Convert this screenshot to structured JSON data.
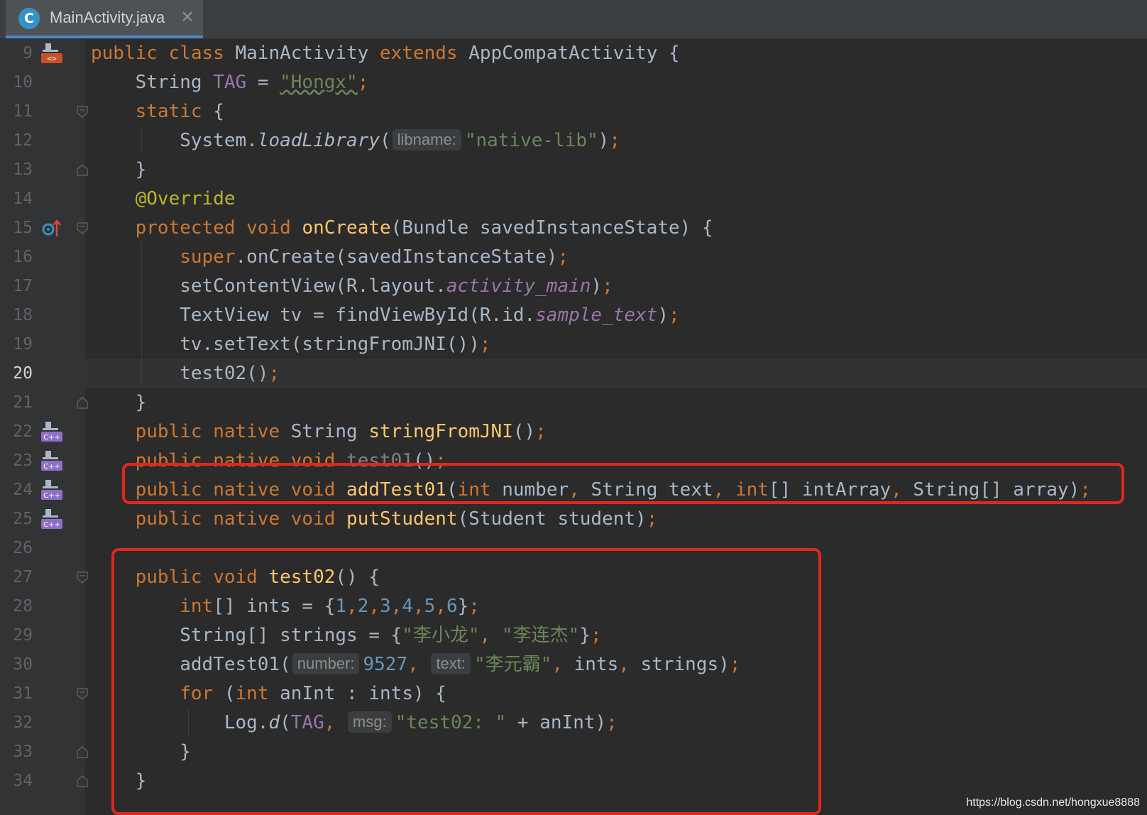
{
  "tab": {
    "icon_letter": "C",
    "title": "MainActivity.java",
    "close": "✕"
  },
  "editor": {
    "current_line": 20,
    "hints": {
      "libname": "libname:",
      "number": "number:",
      "text": "text:",
      "msg": "msg:"
    },
    "strings": {
      "hongx": "\"Hongx\"",
      "native_lib": "\"native-lib\"",
      "li1": "\"李小龙\"",
      "li2": "\"李连杰\"",
      "li3": "\"李元霸\"",
      "test02msg": "\"test02: \""
    },
    "line_numbers": [
      "9",
      "10",
      "11",
      "12",
      "13",
      "14",
      "15",
      "16",
      "17",
      "18",
      "19",
      "20",
      "21",
      "22",
      "23",
      "24",
      "25",
      "26",
      "27",
      "28",
      "29",
      "30",
      "31",
      "32",
      "33",
      "34"
    ]
  },
  "gutter_icons": {
    "line9": "java-to-native-icon",
    "line15": "override-method-icon",
    "lines22_25": "cpp-native-icon",
    "cpp_label": "C++"
  },
  "watermark": "https://blog.csdn.net/hongxue8888",
  "colors": {
    "background": "#2b2b2b",
    "keyword": "#cc7832",
    "string": "#6a8759",
    "number": "#6897bb",
    "annotation": "#bbb529",
    "method": "#ffc66d",
    "field": "#9876aa",
    "highlight_box": "#e0271f"
  }
}
